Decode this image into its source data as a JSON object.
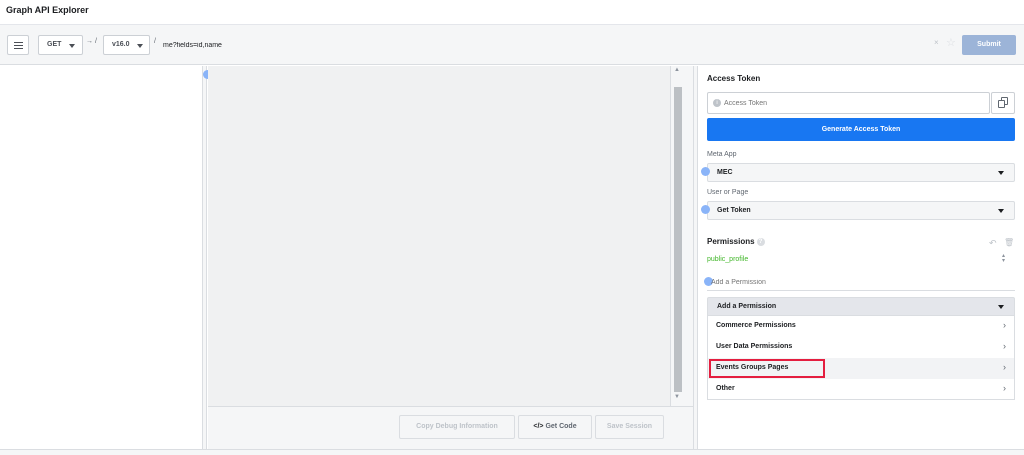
{
  "header": {
    "title": "Graph API Explorer"
  },
  "toolbar": {
    "method": "GET",
    "arrow_sep": "→ /",
    "version": "v16.0",
    "slash_sep": "/",
    "query_value": "me?fields=id,name",
    "clear_glyph": "×",
    "star_glyph": "☆",
    "submit_label": "Submit"
  },
  "center": {
    "copy_debug_label": "Copy Debug Information",
    "get_code_icon": "</>",
    "get_code_label": "Get Code",
    "save_session_label": "Save Session"
  },
  "right": {
    "access_token_title": "Access Token",
    "access_token_placeholder": "Access Token",
    "generate_label": "Generate Access Token",
    "meta_app_label": "Meta App",
    "meta_app_value": "MEC",
    "user_or_page_label": "User or Page",
    "user_or_page_value": "Get Token",
    "permissions_title": "Permissions",
    "permissions": [
      "public_profile"
    ],
    "add_permission_placeholder": "Add a Permission",
    "add_permission_dropdown": "Add a Permission",
    "dropdown_items": [
      {
        "label": "Commerce Permissions"
      },
      {
        "label": "User Data Permissions"
      },
      {
        "label": "Events Groups Pages"
      },
      {
        "label": "Other"
      }
    ],
    "highlighted_item": "Events Groups Pages"
  },
  "icons": {
    "menu": "hamburger-icon",
    "copy": "copy-icon",
    "info": "info-icon",
    "help": "help-icon",
    "undo": "undo-icon",
    "trash": "trash-icon",
    "chevron": "chevron-right-icon"
  },
  "colors": {
    "primary": "#1877f2",
    "submit_disabled": "#9cb4d8",
    "permission_text": "#42b72a",
    "highlight_border": "#e41e3f"
  }
}
